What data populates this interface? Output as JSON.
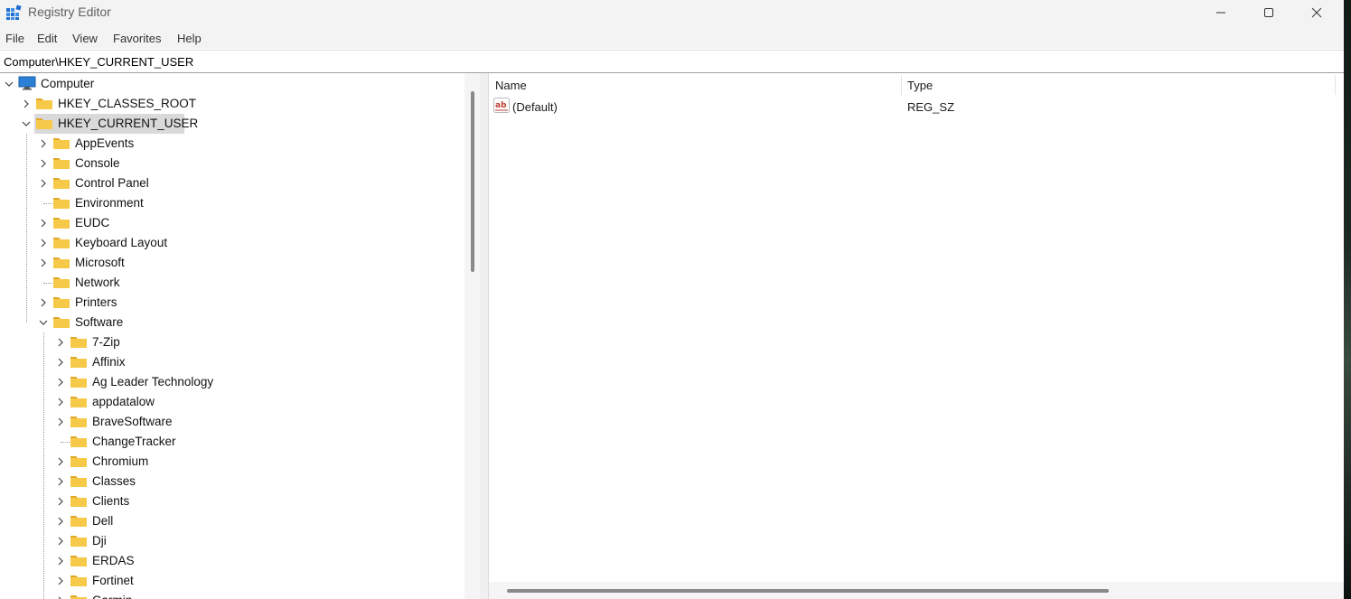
{
  "window": {
    "title": "Registry Editor",
    "controls": [
      "minimize-icon",
      "maximize-icon",
      "close-icon"
    ]
  },
  "menu": [
    "File",
    "Edit",
    "View",
    "Favorites",
    "Help"
  ],
  "address": "Computer\\HKEY_CURRENT_USER",
  "tree": {
    "root": "Computer",
    "hives": [
      "HKEY_CLASSES_ROOT",
      "HKEY_CURRENT_USER"
    ],
    "selected": "HKEY_CURRENT_USER",
    "current_user_children": [
      "AppEvents",
      "Console",
      "Control Panel",
      "Environment",
      "EUDC",
      "Keyboard Layout",
      "Microsoft",
      "Network",
      "Printers",
      "Software"
    ],
    "software_children": [
      "7-Zip",
      "Affinix",
      "Ag Leader Technology",
      "appdatalow",
      "BraveSoftware",
      "ChangeTracker",
      "Chromium",
      "Classes",
      "Clients",
      "Dell",
      "Dji",
      "ERDAS",
      "Fortinet",
      "Garmin"
    ]
  },
  "list": {
    "columns": [
      "Name",
      "Type"
    ],
    "rows": [
      {
        "name": "(Default)",
        "type": "REG_SZ",
        "icon": "string-value-icon"
      }
    ]
  },
  "colors": {
    "folder": "#f7c948",
    "folder_dark": "#e0a826",
    "selection": "#d9d9d9",
    "window_bg": "#f3f3f3"
  }
}
